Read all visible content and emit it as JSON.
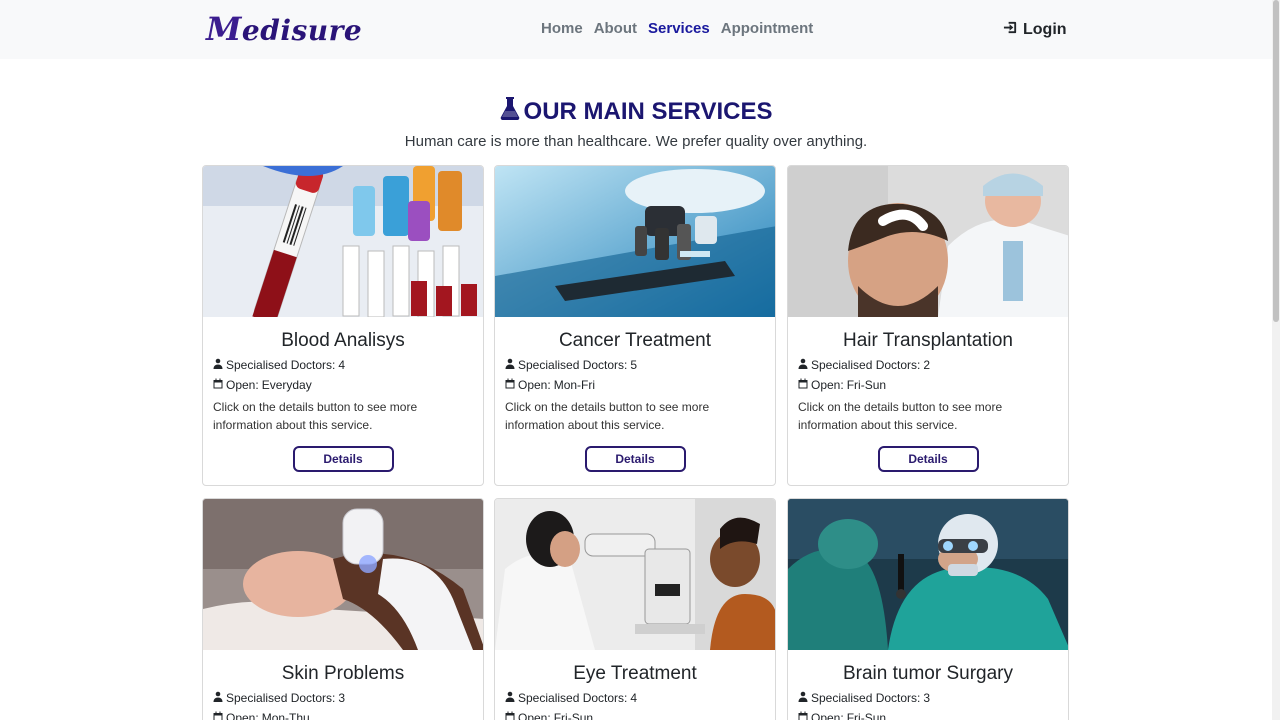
{
  "brand": "Medisure",
  "nav": {
    "items": [
      "Home",
      "About",
      "Services",
      "Appointment"
    ],
    "active": "Services"
  },
  "login_label": "Login",
  "section": {
    "title": "OUR MAIN SERVICES",
    "subtitle": "Human care is more than healthcare. We prefer quality over anything."
  },
  "labels": {
    "doctors_prefix": "Specialised Doctors: ",
    "open_prefix": "Open: ",
    "description": "Click on the details button to see more information about this service.",
    "button": "Details"
  },
  "services": [
    {
      "name": "Blood Analisys",
      "doctors": "4",
      "open": "Everyday"
    },
    {
      "name": "Cancer Treatment",
      "doctors": "5",
      "open": "Mon-Fri"
    },
    {
      "name": "Hair Transplantation",
      "doctors": "2",
      "open": "Fri-Sun"
    },
    {
      "name": "Skin Problems",
      "doctors": "3",
      "open": "Mon-Thu"
    },
    {
      "name": "Eye Treatment",
      "doctors": "4",
      "open": "Fri-Sun"
    },
    {
      "name": "Brain tumor Surgary",
      "doctors": "3",
      "open": "Fri-Sun"
    }
  ],
  "icons": {
    "section": "flask-icon",
    "login": "sign-in-icon",
    "doctors": "user-doctor-icon",
    "open": "calendar-icon"
  },
  "colors": {
    "brand": "#2a1478",
    "accent": "#1b1670",
    "nav_active": "#1a1a9e",
    "nav_inactive": "#6c757d"
  }
}
